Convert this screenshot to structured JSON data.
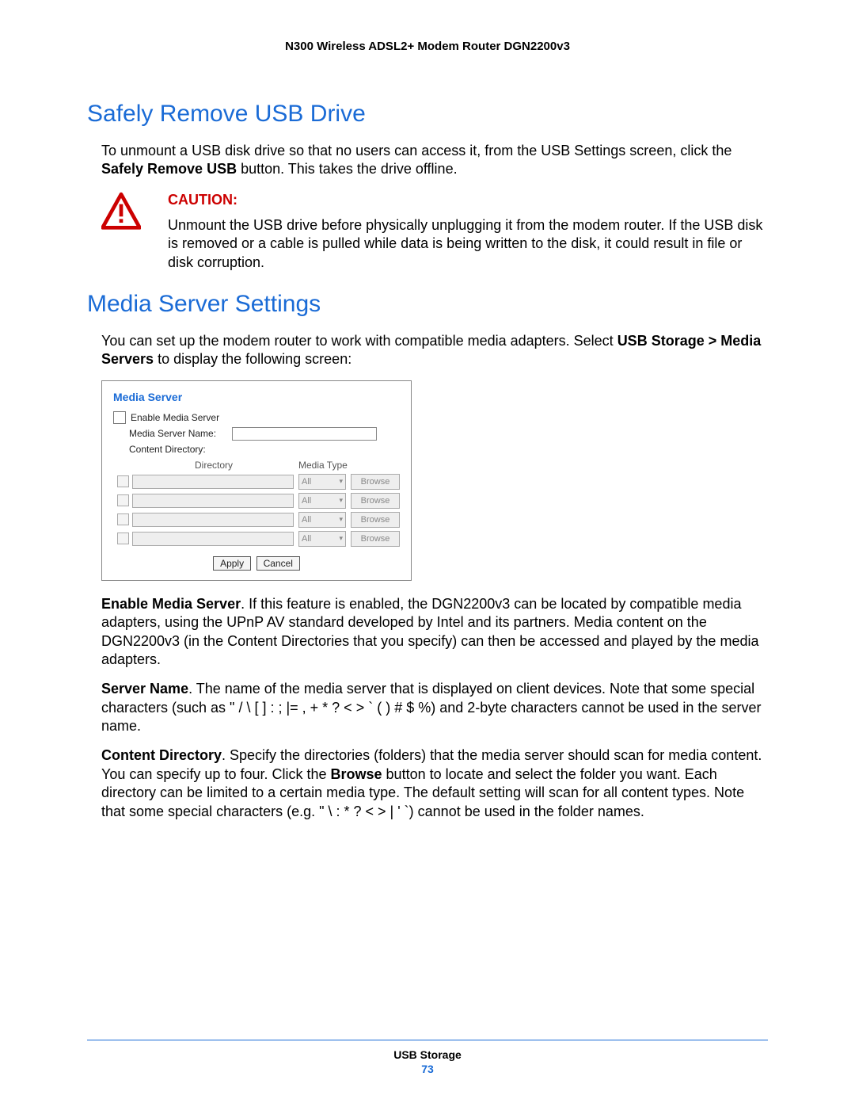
{
  "header": "N300 Wireless ADSL2+ Modem Router DGN2200v3",
  "section1": {
    "title": "Safely Remove USB Drive",
    "intro_pre": "To unmount a USB disk drive so that no users can access it, from the USB Settings screen, click the ",
    "intro_bold": "Safely Remove USB",
    "intro_post": " button. This takes the drive offline.",
    "caution_label": "CAUTION:",
    "caution_body": "Unmount the USB drive before physically unplugging it from the modem router. If the USB disk is removed or a cable is pulled while data is being written to the disk, it could result in file or disk corruption."
  },
  "section2": {
    "title": "Media Server Settings",
    "intro_pre": "You can set up the modem router to work with compatible media adapters. Select ",
    "intro_bold": "USB Storage > Media Servers",
    "intro_post": " to display the following screen:"
  },
  "panel": {
    "title": "Media Server",
    "enable_label": "Enable Media Server",
    "name_label": "Media Server Name:",
    "name_value": "",
    "dir_label": "Content Directory:",
    "col_directory": "Directory",
    "col_mediatype": "Media Type",
    "row_select_value": "All",
    "row_browse_label": "Browse",
    "rows": 4,
    "apply_label": "Apply",
    "cancel_label": "Cancel"
  },
  "desc": {
    "p1_bold": "Enable Media Server",
    "p1_rest": ". If this feature is enabled, the DGN2200v3 can be located by compatible media adapters, using the UPnP AV standard developed by Intel and its partners. Media content on the DGN2200v3 (in the Content Directories that you specify) can then be accessed and played by the media adapters.",
    "p2_bold": "Server Name",
    "p2_rest": ". The name of the media server that is displayed on client devices. Note that some special characters (such as \" / \\ [ ] : ; |= , + * ? < > ` ( ) # $ %) and 2-byte characters cannot be used in the server name.",
    "p3_bold": "Content Directory",
    "p3_a": ". Specify the directories (folders) that the media server should scan for media content. You can specify up to four. Click the ",
    "p3_bold2": "Browse",
    "p3_b": " button to locate and select the folder you want. Each directory can be limited to a certain media type. The default setting will scan for all content types. Note that some special characters (e.g. \" \\ : * ? < > | ' `) cannot be used in the folder names."
  },
  "footer": {
    "section": "USB Storage",
    "page": "73"
  }
}
